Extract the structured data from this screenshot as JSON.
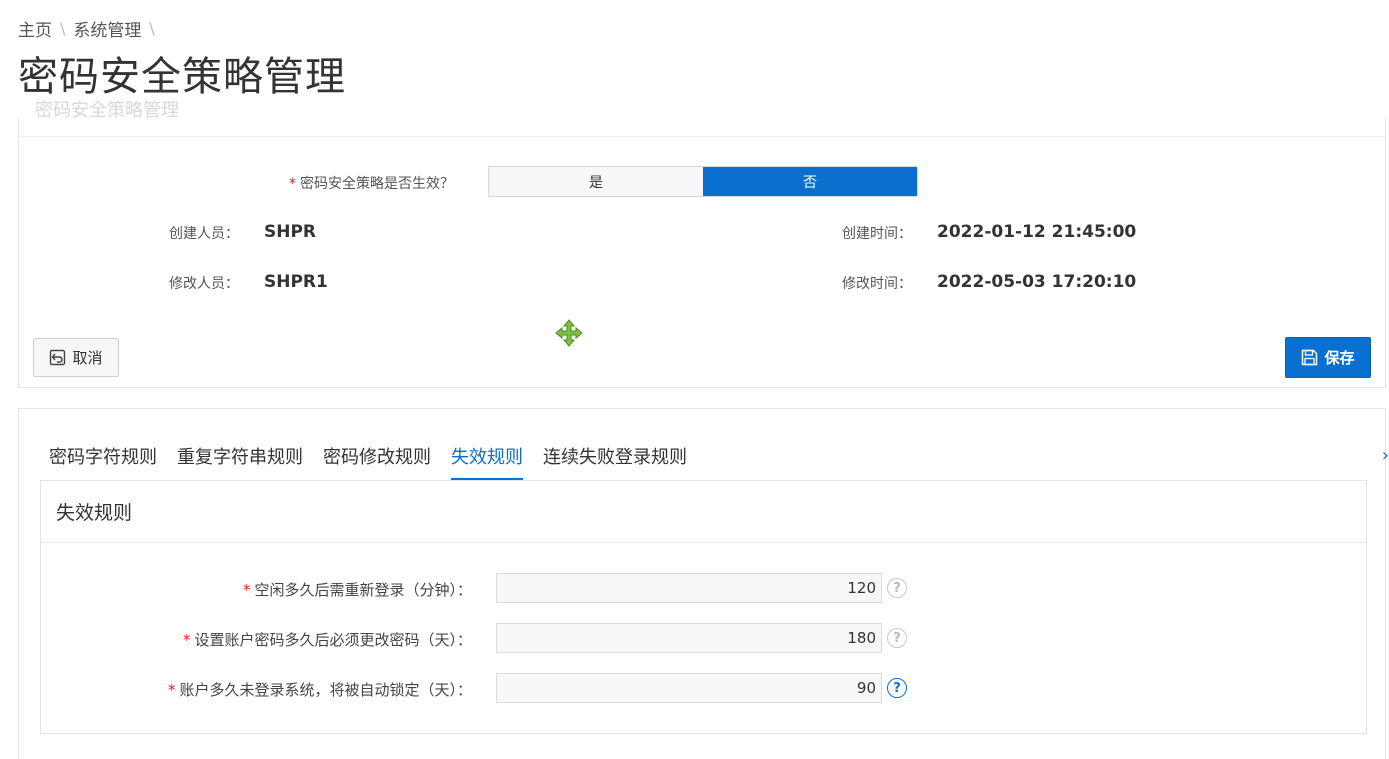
{
  "breadcrumb": {
    "home": "主页",
    "sep": "\\",
    "system": "系统管理"
  },
  "page": {
    "title": "密码安全策略管理",
    "subtitle": "密码安全策略管理"
  },
  "policy": {
    "enabled_label": "密码安全策略是否生效？",
    "required_mark": "*",
    "option_yes": "是",
    "option_no": "否",
    "selected": "否",
    "creator_label": "创建人员：",
    "creator_value": "SHPR",
    "created_time_label": "创建时间：",
    "created_time_value": "2022-01-12 21:45:00",
    "modifier_label": "修改人员：",
    "modifier_value": "SHPR1",
    "modified_time_label": "修改时间：",
    "modified_time_value": "2022-05-03 17:20:10"
  },
  "actions": {
    "cancel": "取消",
    "save": "保存"
  },
  "tabs": [
    {
      "label": "密码字符规则",
      "active": false
    },
    {
      "label": "重复字符串规则",
      "active": false
    },
    {
      "label": "密码修改规则",
      "active": false
    },
    {
      "label": "失效规则",
      "active": true
    },
    {
      "label": "连续失败登录规则",
      "active": false
    }
  ],
  "expiry": {
    "header": "失效规则",
    "fields": [
      {
        "label": "空闲多久后需重新登录（分钟）：",
        "value": "120",
        "help": "?"
      },
      {
        "label": "设置账户密码多久后必须更改密码（天）：",
        "value": "180",
        "help": "?"
      },
      {
        "label": "账户多久未登录系统，将被自动锁定（天）：",
        "value": "90",
        "help": "?"
      }
    ]
  },
  "colors": {
    "accent": "#0a70cf",
    "required": "#e02020",
    "move_icon": "#7cc242"
  },
  "icons": {
    "cancel": "undo-icon",
    "save": "floppy-disk-icon",
    "move": "move-cursor-icon",
    "help": "question-circle-icon",
    "scroll": "chevron-right-icon"
  }
}
